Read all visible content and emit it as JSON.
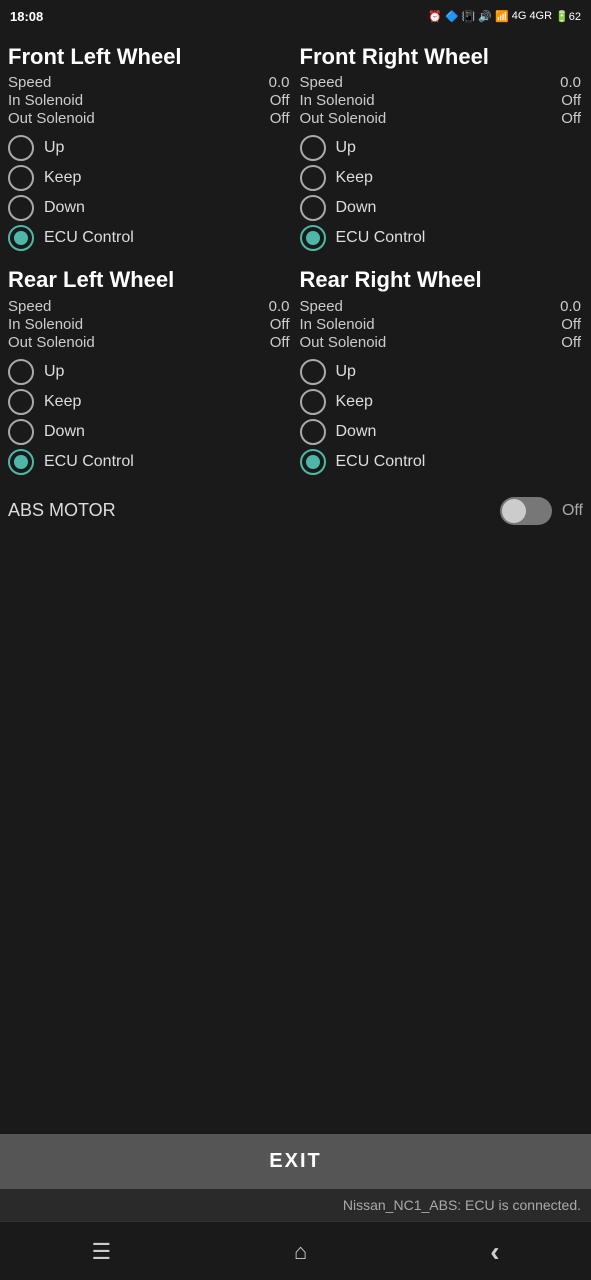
{
  "statusBar": {
    "time": "18:08",
    "rightIcons": "⏰ 🔵 📳 🔊 4G 4GR 62%"
  },
  "frontLeft": {
    "title": "Front Left Wheel",
    "speed": {
      "label": "Speed",
      "value": "0.0"
    },
    "inSolenoid": {
      "label": "In Solenoid",
      "value": "Off"
    },
    "outSolenoid": {
      "label": "Out Solenoid",
      "value": "Off"
    },
    "radios": [
      {
        "id": "fl-up",
        "label": "Up",
        "selected": false
      },
      {
        "id": "fl-keep",
        "label": "Keep",
        "selected": false
      },
      {
        "id": "fl-down",
        "label": "Down",
        "selected": false
      },
      {
        "id": "fl-ecu",
        "label": "ECU Control",
        "selected": true
      }
    ]
  },
  "frontRight": {
    "title": "Front Right Wheel",
    "speed": {
      "label": "Speed",
      "value": "0.0"
    },
    "inSolenoid": {
      "label": "In Solenoid",
      "value": "Off"
    },
    "outSolenoid": {
      "label": "Out Solenoid",
      "value": "Off"
    },
    "radios": [
      {
        "id": "fr-up",
        "label": "Up",
        "selected": false
      },
      {
        "id": "fr-keep",
        "label": "Keep",
        "selected": false
      },
      {
        "id": "fr-down",
        "label": "Down",
        "selected": false
      },
      {
        "id": "fr-ecu",
        "label": "ECU Control",
        "selected": true
      }
    ]
  },
  "rearLeft": {
    "title": "Rear Left Wheel",
    "speed": {
      "label": "Speed",
      "value": "0.0"
    },
    "inSolenoid": {
      "label": "In Solenoid",
      "value": "Off"
    },
    "outSolenoid": {
      "label": "Out Solenoid",
      "value": "Off"
    },
    "radios": [
      {
        "id": "rl-up",
        "label": "Up",
        "selected": false
      },
      {
        "id": "rl-keep",
        "label": "Keep",
        "selected": false
      },
      {
        "id": "rl-down",
        "label": "Down",
        "selected": false
      },
      {
        "id": "rl-ecu",
        "label": "ECU Control",
        "selected": true
      }
    ]
  },
  "rearRight": {
    "title": "Rear Right Wheel",
    "speed": {
      "label": "Speed",
      "value": "0.0"
    },
    "inSolenoid": {
      "label": "In Solenoid",
      "value": "Off"
    },
    "outSolenoid": {
      "label": "Out Solenoid",
      "value": "Off"
    },
    "radios": [
      {
        "id": "rr-up",
        "label": "Up",
        "selected": false
      },
      {
        "id": "rr-keep",
        "label": "Keep",
        "selected": false
      },
      {
        "id": "rr-down",
        "label": "Down",
        "selected": false
      },
      {
        "id": "rr-ecu",
        "label": "ECU Control",
        "selected": true
      }
    ]
  },
  "absMotor": {
    "label": "ABS MOTOR",
    "state": "off",
    "stateLabel": "Off"
  },
  "exitButton": {
    "label": "EXIT"
  },
  "ecuStatus": {
    "text": "Nissan_NC1_ABS: ECU is connected."
  },
  "nav": {
    "menuIcon": "☰",
    "homeIcon": "⌂",
    "backIcon": "‹"
  }
}
